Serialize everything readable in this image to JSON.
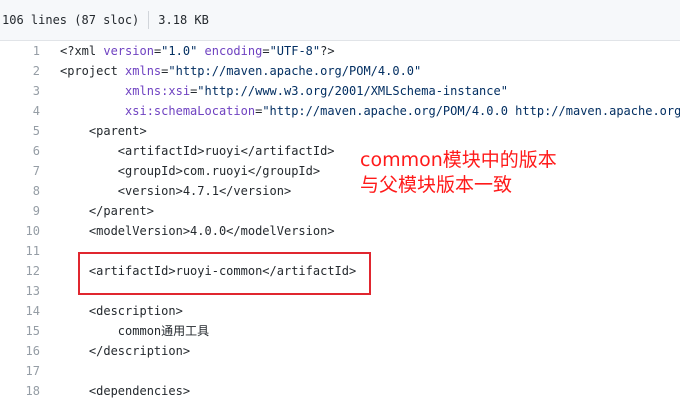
{
  "file_info": {
    "lines": "106 lines (87 sloc)",
    "size": "3.18 KB"
  },
  "code_lines": [
    {
      "n": "1",
      "indent": "",
      "parts": [
        [
          "plain",
          "<?xml "
        ],
        [
          "attr",
          "version"
        ],
        [
          "plain",
          "="
        ],
        [
          "str",
          "\"1.0\""
        ],
        [
          "plain",
          " "
        ],
        [
          "attr",
          "encoding"
        ],
        [
          "plain",
          "="
        ],
        [
          "str",
          "\"UTF-8\""
        ],
        [
          "plain",
          "?>"
        ]
      ]
    },
    {
      "n": "2",
      "indent": "",
      "parts": [
        [
          "plain",
          "<project "
        ],
        [
          "attr",
          "xmlns"
        ],
        [
          "plain",
          "="
        ],
        [
          "str",
          "\"http://maven.apache.org/POM/4.0.0\""
        ]
      ]
    },
    {
      "n": "3",
      "indent": "         ",
      "parts": [
        [
          "attr",
          "xmlns:xsi"
        ],
        [
          "plain",
          "="
        ],
        [
          "str",
          "\"http://www.w3.org/2001/XMLSchema-instance\""
        ]
      ]
    },
    {
      "n": "4",
      "indent": "         ",
      "parts": [
        [
          "attr",
          "xsi:schemaLocation"
        ],
        [
          "plain",
          "="
        ],
        [
          "str",
          "\"http://maven.apache.org/POM/4.0.0 http://maven.apache.org"
        ]
      ]
    },
    {
      "n": "5",
      "indent": "    ",
      "parts": [
        [
          "plain",
          "<parent>"
        ]
      ]
    },
    {
      "n": "6",
      "indent": "        ",
      "parts": [
        [
          "plain",
          "<artifactId>ruoyi</artifactId>"
        ]
      ]
    },
    {
      "n": "7",
      "indent": "        ",
      "parts": [
        [
          "plain",
          "<groupId>com.ruoyi</groupId>"
        ]
      ]
    },
    {
      "n": "8",
      "indent": "        ",
      "parts": [
        [
          "plain",
          "<version>4.7.1</version>"
        ]
      ]
    },
    {
      "n": "9",
      "indent": "    ",
      "parts": [
        [
          "plain",
          "</parent>"
        ]
      ]
    },
    {
      "n": "10",
      "indent": "    ",
      "parts": [
        [
          "plain",
          "<modelVersion>4.0.0</modelVersion>"
        ]
      ]
    },
    {
      "n": "11",
      "indent": "",
      "parts": []
    },
    {
      "n": "12",
      "indent": "    ",
      "parts": [
        [
          "plain",
          "<artifactId>ruoyi-common</artifactId>"
        ]
      ]
    },
    {
      "n": "13",
      "indent": "",
      "parts": []
    },
    {
      "n": "14",
      "indent": "    ",
      "parts": [
        [
          "plain",
          "<description>"
        ]
      ]
    },
    {
      "n": "15",
      "indent": "        ",
      "parts": [
        [
          "plain",
          "common通用工具"
        ]
      ]
    },
    {
      "n": "16",
      "indent": "    ",
      "parts": [
        [
          "plain",
          "</description>"
        ]
      ]
    },
    {
      "n": "17",
      "indent": "",
      "parts": []
    },
    {
      "n": "18",
      "indent": "    ",
      "parts": [
        [
          "plain",
          "<dependencies>"
        ]
      ]
    }
  ],
  "annotation": {
    "line1": "common模块中的版本",
    "line2": "与父模块版本一致",
    "color": "#ff1a1a"
  },
  "highlight_color": "#e0262f"
}
